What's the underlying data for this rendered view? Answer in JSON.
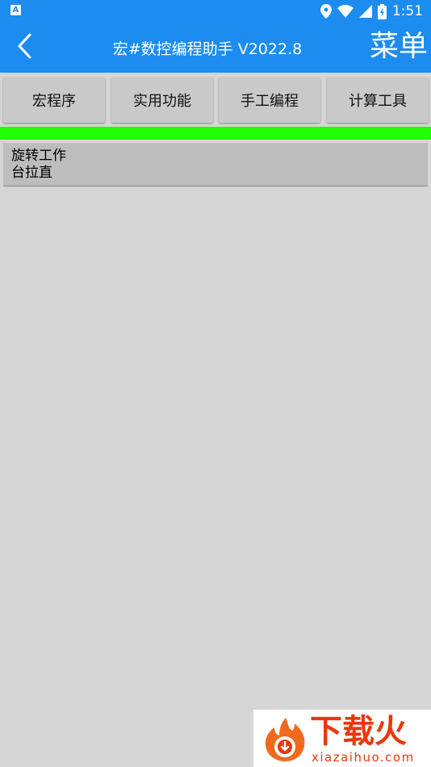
{
  "status_bar": {
    "notification_glyph": "A",
    "time": "1:51",
    "icons": [
      "location-icon",
      "wifi-icon",
      "signal-icon",
      "battery-icon"
    ]
  },
  "toolbar": {
    "title": "宏#数控编程助手 V2022.8",
    "menu_label": "菜单",
    "back_icon": "chevron-left-icon"
  },
  "tabs": [
    {
      "label": "宏程序"
    },
    {
      "label": "实用功能"
    },
    {
      "label": "手工编程"
    },
    {
      "label": "计算工具"
    }
  ],
  "list": {
    "items": [
      {
        "line1": "旋转工作",
        "line2": "台拉直"
      }
    ]
  },
  "watermark": {
    "brand": "下载火",
    "url": "xiazaihuo.com"
  },
  "colors": {
    "accent": "#1c8cf0",
    "progress_bar": "#21ff00",
    "background": "#d6d6d6",
    "watermark": "#e8380d"
  }
}
